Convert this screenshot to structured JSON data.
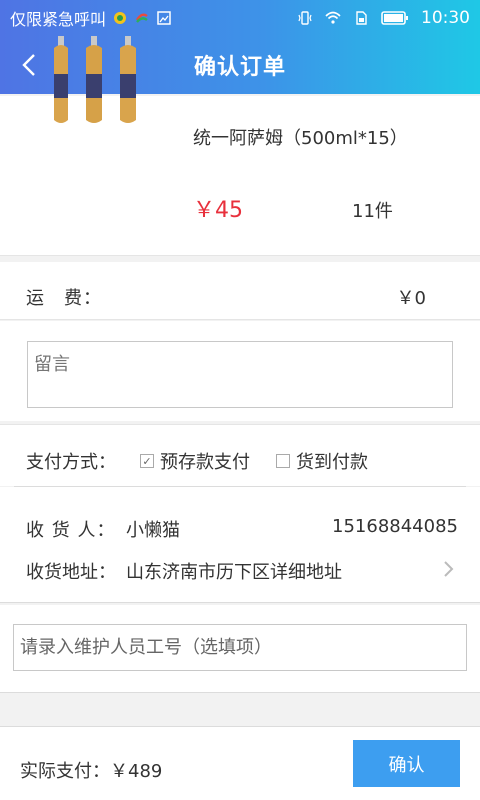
{
  "status_bar": {
    "carrier": "仅限紧急呼叫",
    "time": "10:30"
  },
  "header": {
    "title": "确认订单"
  },
  "product": {
    "name": "统一阿萨姆（500ml*15）",
    "price": "￥45",
    "quantity": "11件"
  },
  "shipping": {
    "label": "运　费：",
    "value": "￥0"
  },
  "remark": {
    "placeholder": "留言"
  },
  "payment": {
    "label": "支付方式：",
    "options": [
      {
        "label": "预存款支付",
        "checked": true
      },
      {
        "label": "货到付款",
        "checked": false
      }
    ]
  },
  "receiver": {
    "name_label": "收 货 人：",
    "name": "小懒猫",
    "phone": "15168844085",
    "address_label": "收货地址：",
    "address": "山东济南市历下区详细地址"
  },
  "staff": {
    "placeholder": "请录入维护人员工号（选填项）"
  },
  "footer": {
    "total": "实际支付：￥489",
    "confirm_label": "确认"
  },
  "colors": {
    "accent": "#3d9ef0",
    "price": "#e8303c",
    "header_gradient_start": "#4f74e4",
    "header_gradient_end": "#1fc8e6"
  }
}
